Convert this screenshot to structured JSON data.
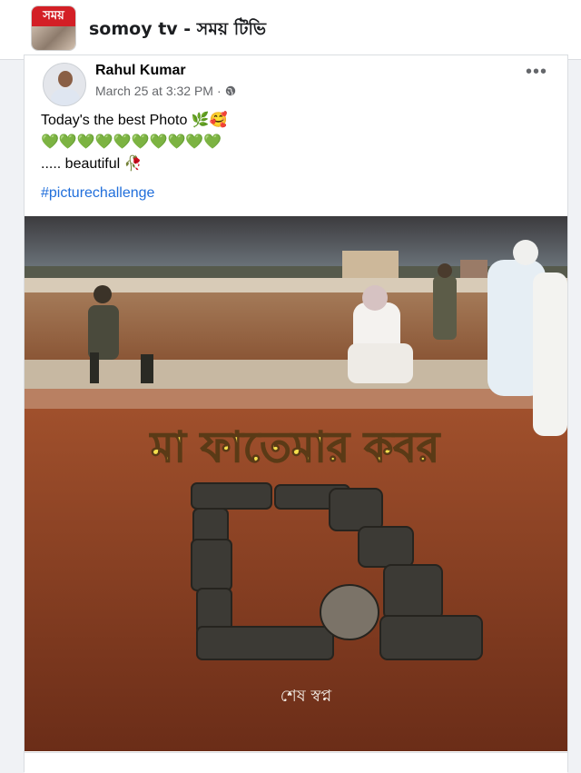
{
  "header": {
    "channel_logo_text": "সময়",
    "channel_title": "somoy tv - সময় টিভি"
  },
  "post": {
    "author": "Rahul Kumar",
    "timestamp": "March 25 at 3:32 PM",
    "separator": "·",
    "privacy_icon": "globe-icon",
    "more_icon": "more-horizontal-icon",
    "more_label": "•••",
    "lines": [
      "Today's the best Photo 🌿🥰",
      "💚💚💚💚💚💚💚💚💚💚",
      "..... beautiful 🥀"
    ],
    "hashtag": "#picturechallenge"
  },
  "photo": {
    "caption_main": "মা ফাতেমার কবর",
    "caption_small": "শেষ স্বপ্ন"
  },
  "colors": {
    "accent_link": "#216fdb",
    "caption_yellow": "#f4e04d",
    "brand_red": "#d31f26"
  }
}
